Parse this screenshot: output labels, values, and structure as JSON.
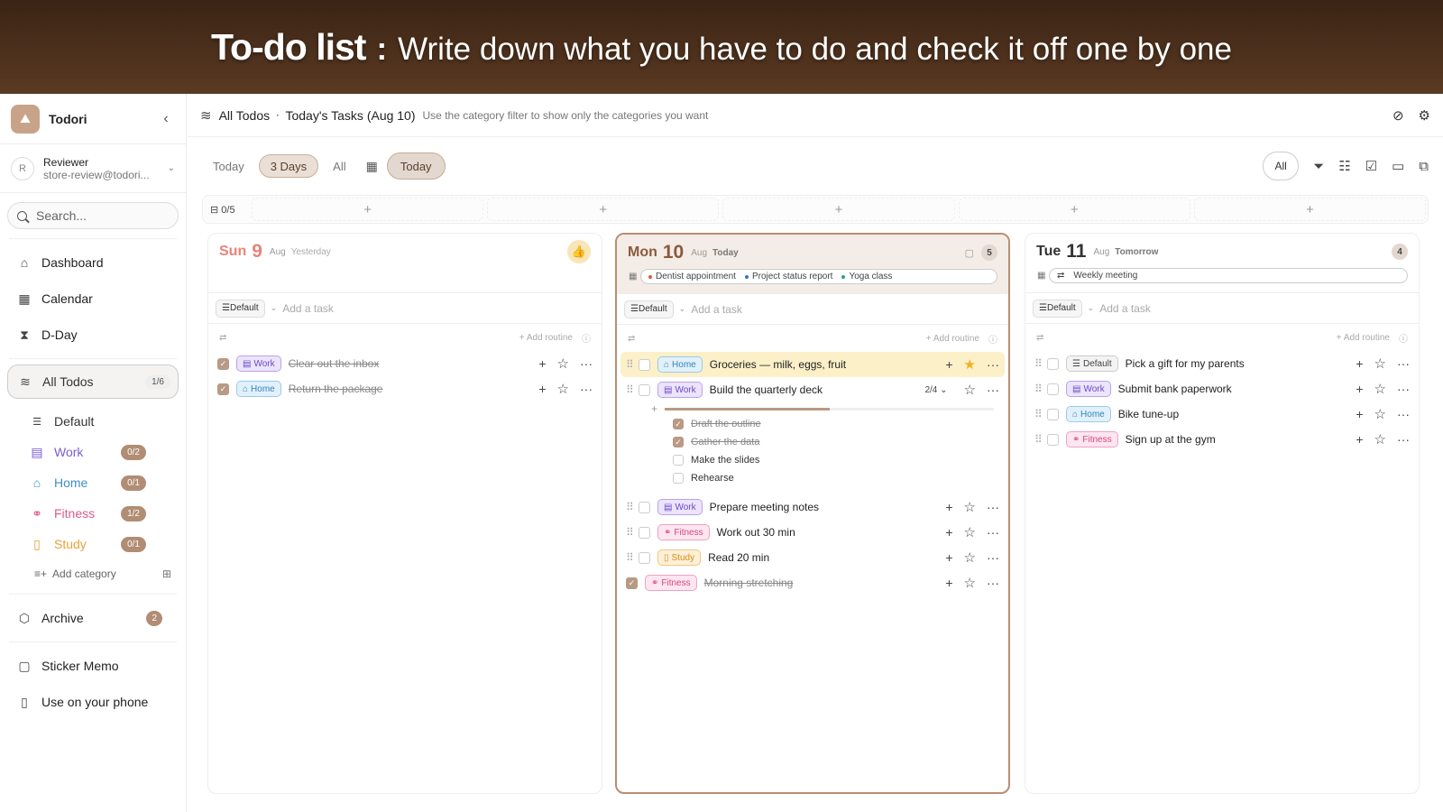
{
  "banner": {
    "bold": "To-do list",
    "sep": ":",
    "rest": "Write down what you have to do and check it off one by one"
  },
  "app": {
    "name": "Todori"
  },
  "user": {
    "initial": "R",
    "name": "Reviewer",
    "email": "store-review@todori..."
  },
  "search": {
    "placeholder": "Search..."
  },
  "nav": {
    "dashboard": "Dashboard",
    "calendar": "Calendar",
    "dday": "D-Day",
    "all_todos": "All Todos",
    "all_todos_count": "1/6",
    "archive": "Archive",
    "archive_count": "2",
    "sticker": "Sticker Memo",
    "phone": "Use on your phone"
  },
  "categories": [
    {
      "name": "Default",
      "count": "",
      "color": "#333333"
    },
    {
      "name": "Work",
      "count": "0/2",
      "color": "#7b5bd6"
    },
    {
      "name": "Home",
      "count": "0/1",
      "color": "#3d8fc9"
    },
    {
      "name": "Fitness",
      "count": "1/2",
      "color": "#e05a8c"
    },
    {
      "name": "Study",
      "count": "0/1",
      "color": "#e6a23c"
    }
  ],
  "add_category": "Add category",
  "topbar": {
    "title": "All Todos",
    "sep": "·",
    "subtitle": "Today's Tasks (Aug 10)",
    "hint": "Use the category filter to show only the categories you want"
  },
  "controls": {
    "today": "Today",
    "three_days": "3 Days",
    "all": "All",
    "today_btn": "Today",
    "filter_all": "All"
  },
  "inbox": {
    "count": "0/5"
  },
  "columns": [
    {
      "dow": "Sun",
      "num": "9",
      "mon": "Aug",
      "rel": "Yesterday",
      "color": "#e8837a"
    },
    {
      "dow": "Mon",
      "num": "10",
      "mon": "Aug",
      "rel": "Today",
      "count": "5",
      "color": "#8a5a3c",
      "events": [
        "Dentist appointment",
        "Project status report",
        "Yoga class"
      ]
    },
    {
      "dow": "Tue",
      "num": "11",
      "mon": "Aug",
      "rel": "Tomorrow",
      "count": "4",
      "color": "#333333",
      "events": [
        "Weekly meeting"
      ]
    }
  ],
  "common": {
    "default": "Default",
    "add_task": "Add a task",
    "add_routine": "+ Add routine"
  },
  "tasks": {
    "sun": [
      {
        "tag": "Work",
        "name": "Clear out the inbox",
        "done": true
      },
      {
        "tag": "Home",
        "name": "Return the package",
        "done": true
      }
    ],
    "mon": [
      {
        "tag": "Home",
        "name": "Groceries — milk, eggs, fruit",
        "done": false,
        "starred": true
      },
      {
        "tag": "Work",
        "name": "Build the quarterly deck",
        "done": false,
        "progress_label": "2/4",
        "progress": 0.5,
        "subtasks": [
          {
            "name": "Draft the outline",
            "done": true
          },
          {
            "name": "Gather the data",
            "done": true
          },
          {
            "name": "Make the slides",
            "done": false
          },
          {
            "name": "Rehearse",
            "done": false
          }
        ]
      },
      {
        "tag": "Work",
        "name": "Prepare meeting notes",
        "done": false
      },
      {
        "tag": "Fitness",
        "name": "Work out 30 min",
        "done": false
      },
      {
        "tag": "Study",
        "name": "Read 20 min",
        "done": false
      },
      {
        "tag": "Fitness",
        "name": "Morning stretching",
        "done": true
      }
    ],
    "tue": [
      {
        "tag": "Default",
        "name": "Pick a gift for my parents",
        "done": false
      },
      {
        "tag": "Work",
        "name": "Submit bank paperwork",
        "done": false
      },
      {
        "tag": "Home",
        "name": "Bike tune-up",
        "done": false
      },
      {
        "tag": "Fitness",
        "name": "Sign up at the gym",
        "done": false
      }
    ]
  }
}
